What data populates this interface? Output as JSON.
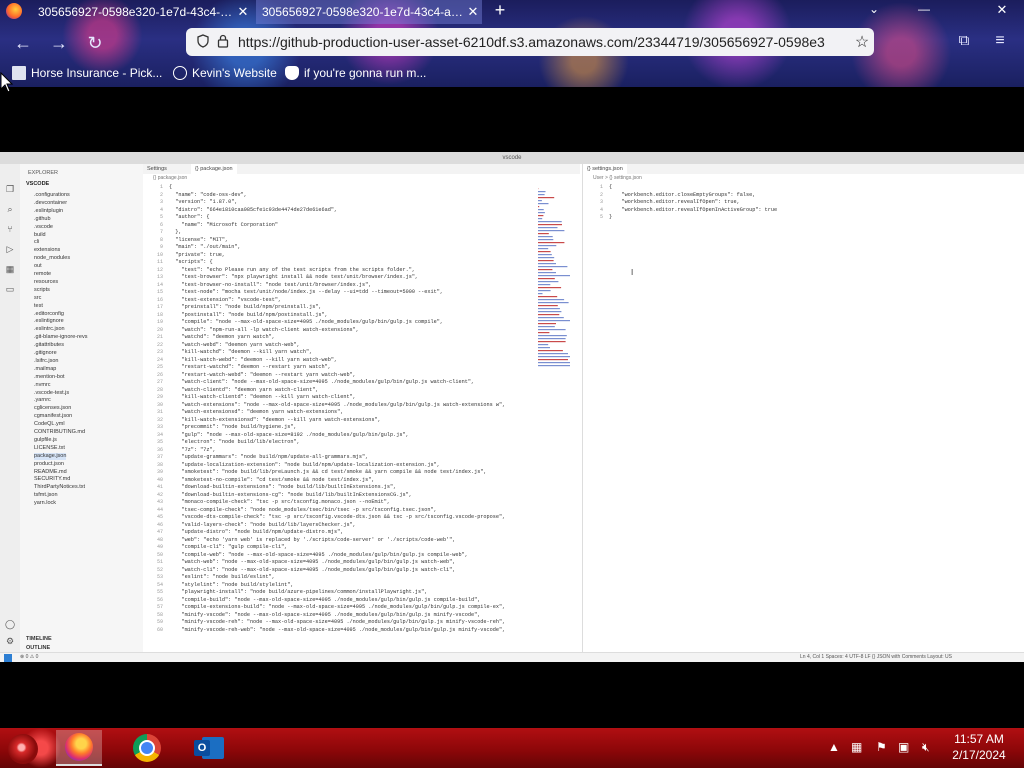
{
  "browser": {
    "tabs": [
      {
        "title": "305656927-0598e320-1e7d-43c4-a1c...",
        "active": false
      },
      {
        "title": "305656927-0598e320-1e7d-43c4-a1c...",
        "active": true
      }
    ],
    "new_tab_glyph": "+",
    "url": "https://github-production-user-asset-6210df.s3.amazonaws.com/23344719/305656927-0598e3",
    "bookmarks": [
      {
        "label": "Horse Insurance - Pick...",
        "icon": "document-icon"
      },
      {
        "label": "Kevin's Website",
        "icon": "globe-icon"
      },
      {
        "label": "if you're gonna run m...",
        "icon": "mask-icon"
      }
    ]
  },
  "vscode": {
    "window_title": "vscode",
    "explorer_header": "EXPLORER",
    "root_folder": "VSCODE",
    "explorer_items": [
      ".configurations",
      ".devcontainer",
      ".eslintplugin",
      ".github",
      ".vscode",
      "build",
      "cli",
      "extensions",
      "node_modules",
      "out",
      "remote",
      "resources",
      "scripts",
      "src",
      "test",
      ".editorconfig",
      ".eslintignore",
      ".eslintrc.json",
      ".git-blame-ignore-revs",
      ".gitattributes",
      ".gitignore",
      ".lsifrc.json",
      ".mailmap",
      ".mention-bot",
      ".nvmrc",
      ".vscode-test.js",
      ".yarnrc",
      "cglicenses.json",
      "cgmanifest.json",
      "CodeQL.yml",
      "CONTRIBUTING.md",
      "gulpfile.js",
      "LICENSE.txt",
      "package.json",
      "product.json",
      "README.md",
      "SECURITY.md",
      "ThirdPartyNotices.txt",
      "tsfmt.json",
      "yarn.lock"
    ],
    "explorer_footer": [
      "TIMELINE",
      "OUTLINE"
    ],
    "editor1_tabs": [
      "Settings",
      "{} package.json"
    ],
    "editor1_crumb": "{} package.json",
    "editor1_lines": [
      "{",
      "  \"name\": \"code-oss-dev\",",
      "  \"version\": \"1.87.0\",",
      "  \"distro\": \"664e1810caa085cfe1c93de4474de27de61e6ad\",",
      "  \"author\": {",
      "    \"name\": \"Microsoft Corporation\"",
      "  },",
      "  \"license\": \"MIT\",",
      "  \"main\": \"./out/main\",",
      "  \"private\": true,",
      "  \"scripts\": {",
      "    \"test\": \"echo Please run any of the test scripts from the scripts folder.\",",
      "    \"test-browser\": \"npx playwright install && node test/unit/browser/index.js\",",
      "    \"test-browser-no-install\": \"node test/unit/browser/index.js\",",
      "    \"test-node\": \"mocha test/unit/node/index.js --delay --ui=tdd --timeout=5000 --exit\",",
      "    \"test-extension\": \"vscode-test\",",
      "    \"preinstall\": \"node build/npm/preinstall.js\",",
      "    \"postinstall\": \"node build/npm/postinstall.js\",",
      "    \"compile\": \"node --max-old-space-size=4095 ./node_modules/gulp/bin/gulp.js compile\",",
      "    \"watch\": \"npm-run-all -lp watch-client watch-extensions\",",
      "    \"watchd\": \"deemon yarn watch\",",
      "    \"watch-webd\": \"deemon yarn watch-web\",",
      "    \"kill-watchd\": \"deemon --kill yarn watch\",",
      "    \"kill-watch-webd\": \"deemon --kill yarn watch-web\",",
      "    \"restart-watchd\": \"deemon --restart yarn watch\",",
      "    \"restart-watch-webd\": \"deemon --restart yarn watch-web\",",
      "    \"watch-client\": \"node --max-old-space-size=4095 ./node_modules/gulp/bin/gulp.js watch-client\",",
      "    \"watch-clientd\": \"deemon yarn watch-client\",",
      "    \"kill-watch-clientd\": \"deemon --kill yarn watch-client\",",
      "    \"watch-extensions\": \"node --max-old-space-size=4095 ./node_modules/gulp/bin/gulp.js watch-extensions w\",",
      "    \"watch-extensionsd\": \"deemon yarn watch-extensions\",",
      "    \"kill-watch-extensionsd\": \"deemon --kill yarn watch-extensions\",",
      "    \"precommit\": \"node build/hygiene.js\",",
      "    \"gulp\": \"node --max-old-space-size=8192 ./node_modules/gulp/bin/gulp.js\",",
      "    \"electron\": \"node build/lib/electron\",",
      "    \"7z\": \"7z\",",
      "    \"update-grammars\": \"node build/npm/update-all-grammars.mjs\",",
      "    \"update-localization-extension\": \"node build/npm/update-localization-extension.js\",",
      "    \"smoketest\": \"node build/lib/preLaunch.js && cd test/smoke && yarn compile && node test/index.js\",",
      "    \"smoketest-no-compile\": \"cd test/smoke && node test/index.js\",",
      "    \"download-builtin-extensions\": \"node build/lib/builtInExtensions.js\",",
      "    \"download-builtin-extensions-cg\": \"node build/lib/builtInExtensionsCG.js\",",
      "    \"monaco-compile-check\": \"tsc -p src/tsconfig.monaco.json --noEmit\",",
      "    \"tsec-compile-check\": \"node node_modules/tsec/bin/tsec -p src/tsconfig.tsec.json\",",
      "    \"vscode-dts-compile-check\": \"tsc -p src/tsconfig.vscode-dts.json && tsc -p src/tsconfig.vscode-propose\",",
      "    \"valid-layers-check\": \"node build/lib/layersChecker.js\",",
      "    \"update-distro\": \"node build/npm/update-distro.mjs\",",
      "    \"web\": \"echo 'yarn web' is replaced by './scripts/code-server' or './scripts/code-web'\",",
      "    \"compile-cli\": \"gulp compile-cli\",",
      "    \"compile-web\": \"node --max-old-space-size=4095 ./node_modules/gulp/bin/gulp.js compile-web\",",
      "    \"watch-web\": \"node --max-old-space-size=4095 ./node_modules/gulp/bin/gulp.js watch-web\",",
      "    \"watch-cli\": \"node --max-old-space-size=4095 ./node_modules/gulp/bin/gulp.js watch-cli\",",
      "    \"eslint\": \"node build/eslint\",",
      "    \"stylelint\": \"node build/stylelint\",",
      "    \"playwright-install\": \"node build/azure-pipelines/common/installPlaywright.js\",",
      "    \"compile-build\": \"node --max-old-space-size=4095 ./node_modules/gulp/bin/gulp.js compile-build\",",
      "    \"compile-extensions-build\": \"node --max-old-space-size=4095 ./node_modules/gulp/bin/gulp.js compile-ex\",",
      "    \"minify-vscode\": \"node --max-old-space-size=4095 ./node_modules/gulp/bin/gulp.js minify-vscode\",",
      "    \"minify-vscode-reh\": \"node --max-old-space-size=4095 ./node_modules/gulp/bin/gulp.js minify-vscode-reh\",",
      "    \"minify-vscode-reh-web\": \"node --max-old-space-size=4095 ./node_modules/gulp/bin/gulp.js minify-vscode\","
    ],
    "editor2_tabs": [
      "{} settings.json"
    ],
    "editor2_crumb": "User > {} settings.json",
    "editor2_lines": [
      "{",
      "    \"workbench.editor.closeEmptyGroups\": false,",
      "    \"workbench.editor.revealIfOpen\": true,",
      "    \"workbench.editor.revealIfOpenInActiveGroup\": true",
      "}"
    ],
    "status_left": "⊗ 0 ⚠ 0",
    "status_right": "Ln 4, Col 1   Spaces: 4   UTF-8   LF   {} JSON with Comments   Layout: US"
  },
  "taskbar": {
    "apps": [
      {
        "name": "firefox",
        "icon": "firefox-icon",
        "active": true
      },
      {
        "name": "chrome",
        "icon": "chrome-icon",
        "active": false
      },
      {
        "name": "outlook",
        "icon": "outlook-icon",
        "active": false
      }
    ],
    "time": "11:57 AM",
    "date": "2/17/2024",
    "tray_icons": [
      "chevron-up-icon",
      "network-icon",
      "flag-icon",
      "display-icon",
      "speaker-muted-icon"
    ]
  },
  "colors": {
    "taskbar": "#8d0709",
    "browser_chrome": "#2a2f83",
    "vscode_keyword": "#1a4fb3",
    "vscode_string": "#a31515"
  }
}
